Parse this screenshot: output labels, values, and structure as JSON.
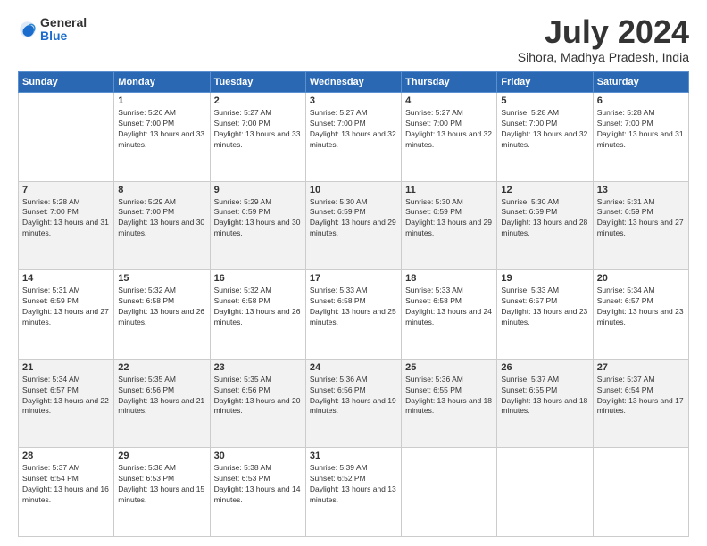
{
  "logo": {
    "general": "General",
    "blue": "Blue"
  },
  "title": {
    "month_year": "July 2024",
    "location": "Sihora, Madhya Pradesh, India"
  },
  "days_of_week": [
    "Sunday",
    "Monday",
    "Tuesday",
    "Wednesday",
    "Thursday",
    "Friday",
    "Saturday"
  ],
  "weeks": [
    [
      {
        "day": "",
        "sunrise": "",
        "sunset": "",
        "daylight": ""
      },
      {
        "day": "1",
        "sunrise": "Sunrise: 5:26 AM",
        "sunset": "Sunset: 7:00 PM",
        "daylight": "Daylight: 13 hours and 33 minutes."
      },
      {
        "day": "2",
        "sunrise": "Sunrise: 5:27 AM",
        "sunset": "Sunset: 7:00 PM",
        "daylight": "Daylight: 13 hours and 33 minutes."
      },
      {
        "day": "3",
        "sunrise": "Sunrise: 5:27 AM",
        "sunset": "Sunset: 7:00 PM",
        "daylight": "Daylight: 13 hours and 32 minutes."
      },
      {
        "day": "4",
        "sunrise": "Sunrise: 5:27 AM",
        "sunset": "Sunset: 7:00 PM",
        "daylight": "Daylight: 13 hours and 32 minutes."
      },
      {
        "day": "5",
        "sunrise": "Sunrise: 5:28 AM",
        "sunset": "Sunset: 7:00 PM",
        "daylight": "Daylight: 13 hours and 32 minutes."
      },
      {
        "day": "6",
        "sunrise": "Sunrise: 5:28 AM",
        "sunset": "Sunset: 7:00 PM",
        "daylight": "Daylight: 13 hours and 31 minutes."
      }
    ],
    [
      {
        "day": "7",
        "sunrise": "Sunrise: 5:28 AM",
        "sunset": "Sunset: 7:00 PM",
        "daylight": "Daylight: 13 hours and 31 minutes."
      },
      {
        "day": "8",
        "sunrise": "Sunrise: 5:29 AM",
        "sunset": "Sunset: 7:00 PM",
        "daylight": "Daylight: 13 hours and 30 minutes."
      },
      {
        "day": "9",
        "sunrise": "Sunrise: 5:29 AM",
        "sunset": "Sunset: 6:59 PM",
        "daylight": "Daylight: 13 hours and 30 minutes."
      },
      {
        "day": "10",
        "sunrise": "Sunrise: 5:30 AM",
        "sunset": "Sunset: 6:59 PM",
        "daylight": "Daylight: 13 hours and 29 minutes."
      },
      {
        "day": "11",
        "sunrise": "Sunrise: 5:30 AM",
        "sunset": "Sunset: 6:59 PM",
        "daylight": "Daylight: 13 hours and 29 minutes."
      },
      {
        "day": "12",
        "sunrise": "Sunrise: 5:30 AM",
        "sunset": "Sunset: 6:59 PM",
        "daylight": "Daylight: 13 hours and 28 minutes."
      },
      {
        "day": "13",
        "sunrise": "Sunrise: 5:31 AM",
        "sunset": "Sunset: 6:59 PM",
        "daylight": "Daylight: 13 hours and 27 minutes."
      }
    ],
    [
      {
        "day": "14",
        "sunrise": "Sunrise: 5:31 AM",
        "sunset": "Sunset: 6:59 PM",
        "daylight": "Daylight: 13 hours and 27 minutes."
      },
      {
        "day": "15",
        "sunrise": "Sunrise: 5:32 AM",
        "sunset": "Sunset: 6:58 PM",
        "daylight": "Daylight: 13 hours and 26 minutes."
      },
      {
        "day": "16",
        "sunrise": "Sunrise: 5:32 AM",
        "sunset": "Sunset: 6:58 PM",
        "daylight": "Daylight: 13 hours and 26 minutes."
      },
      {
        "day": "17",
        "sunrise": "Sunrise: 5:33 AM",
        "sunset": "Sunset: 6:58 PM",
        "daylight": "Daylight: 13 hours and 25 minutes."
      },
      {
        "day": "18",
        "sunrise": "Sunrise: 5:33 AM",
        "sunset": "Sunset: 6:58 PM",
        "daylight": "Daylight: 13 hours and 24 minutes."
      },
      {
        "day": "19",
        "sunrise": "Sunrise: 5:33 AM",
        "sunset": "Sunset: 6:57 PM",
        "daylight": "Daylight: 13 hours and 23 minutes."
      },
      {
        "day": "20",
        "sunrise": "Sunrise: 5:34 AM",
        "sunset": "Sunset: 6:57 PM",
        "daylight": "Daylight: 13 hours and 23 minutes."
      }
    ],
    [
      {
        "day": "21",
        "sunrise": "Sunrise: 5:34 AM",
        "sunset": "Sunset: 6:57 PM",
        "daylight": "Daylight: 13 hours and 22 minutes."
      },
      {
        "day": "22",
        "sunrise": "Sunrise: 5:35 AM",
        "sunset": "Sunset: 6:56 PM",
        "daylight": "Daylight: 13 hours and 21 minutes."
      },
      {
        "day": "23",
        "sunrise": "Sunrise: 5:35 AM",
        "sunset": "Sunset: 6:56 PM",
        "daylight": "Daylight: 13 hours and 20 minutes."
      },
      {
        "day": "24",
        "sunrise": "Sunrise: 5:36 AM",
        "sunset": "Sunset: 6:56 PM",
        "daylight": "Daylight: 13 hours and 19 minutes."
      },
      {
        "day": "25",
        "sunrise": "Sunrise: 5:36 AM",
        "sunset": "Sunset: 6:55 PM",
        "daylight": "Daylight: 13 hours and 18 minutes."
      },
      {
        "day": "26",
        "sunrise": "Sunrise: 5:37 AM",
        "sunset": "Sunset: 6:55 PM",
        "daylight": "Daylight: 13 hours and 18 minutes."
      },
      {
        "day": "27",
        "sunrise": "Sunrise: 5:37 AM",
        "sunset": "Sunset: 6:54 PM",
        "daylight": "Daylight: 13 hours and 17 minutes."
      }
    ],
    [
      {
        "day": "28",
        "sunrise": "Sunrise: 5:37 AM",
        "sunset": "Sunset: 6:54 PM",
        "daylight": "Daylight: 13 hours and 16 minutes."
      },
      {
        "day": "29",
        "sunrise": "Sunrise: 5:38 AM",
        "sunset": "Sunset: 6:53 PM",
        "daylight": "Daylight: 13 hours and 15 minutes."
      },
      {
        "day": "30",
        "sunrise": "Sunrise: 5:38 AM",
        "sunset": "Sunset: 6:53 PM",
        "daylight": "Daylight: 13 hours and 14 minutes."
      },
      {
        "day": "31",
        "sunrise": "Sunrise: 5:39 AM",
        "sunset": "Sunset: 6:52 PM",
        "daylight": "Daylight: 13 hours and 13 minutes."
      },
      {
        "day": "",
        "sunrise": "",
        "sunset": "",
        "daylight": ""
      },
      {
        "day": "",
        "sunrise": "",
        "sunset": "",
        "daylight": ""
      },
      {
        "day": "",
        "sunrise": "",
        "sunset": "",
        "daylight": ""
      }
    ]
  ]
}
